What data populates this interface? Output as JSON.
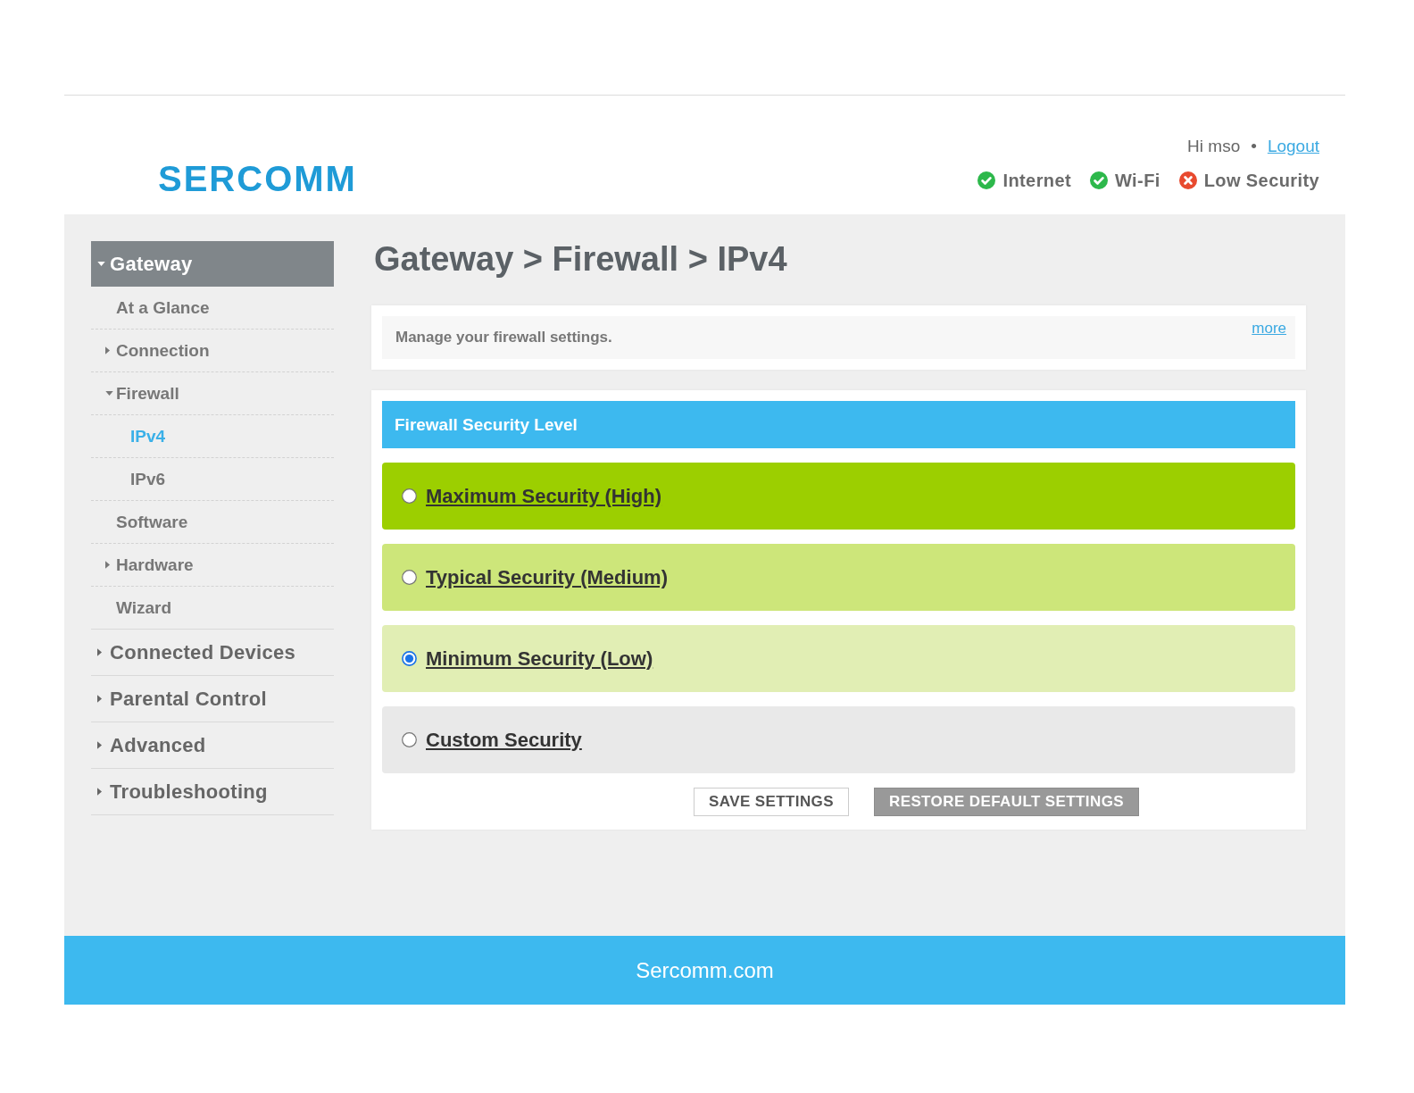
{
  "header": {
    "logo": "SERCOMM",
    "greeting": "Hi mso",
    "separator": "•",
    "logout": "Logout",
    "status": [
      {
        "label": "Internet",
        "ok": true
      },
      {
        "label": "Wi-Fi",
        "ok": true
      },
      {
        "label": "Low Security",
        "ok": false
      }
    ]
  },
  "sidebar": {
    "items": [
      {
        "label": "Gateway",
        "expanded": true,
        "selected": false,
        "children": [
          {
            "label": "At a Glance",
            "selected": false
          },
          {
            "label": "Connection",
            "expanded": false,
            "selected": false
          },
          {
            "label": "Firewall",
            "expanded": true,
            "selected": false,
            "children": [
              {
                "label": "IPv4",
                "selected": true
              },
              {
                "label": "IPv6",
                "selected": false
              }
            ]
          },
          {
            "label": "Software",
            "selected": false
          },
          {
            "label": "Hardware",
            "expanded": false,
            "selected": false
          },
          {
            "label": "Wizard",
            "selected": false
          }
        ]
      },
      {
        "label": "Connected Devices",
        "expanded": false,
        "selected": false
      },
      {
        "label": "Parental Control",
        "expanded": false,
        "selected": false
      },
      {
        "label": "Advanced",
        "expanded": false,
        "selected": false
      },
      {
        "label": "Troubleshooting",
        "expanded": false,
        "selected": false
      }
    ]
  },
  "page": {
    "title": "Gateway > Firewall > IPv4",
    "description": "Manage your firewall settings.",
    "more": "more"
  },
  "firewall": {
    "title": "Firewall Security Level",
    "options": [
      {
        "label": "Maximum Security (High)",
        "color": "#9ccf00",
        "selected": false
      },
      {
        "label": "Typical Security (Medium)",
        "color": "#cde67a",
        "selected": false
      },
      {
        "label": "Minimum Security (Low)",
        "color": "#e1eeb4",
        "selected": true
      },
      {
        "label": "Custom Security",
        "color": "#e9e9e9",
        "selected": false
      }
    ],
    "buttons": [
      {
        "label": "SAVE SETTINGS",
        "kind": "secondary"
      },
      {
        "label": "RESTORE DEFAULT SETTINGS",
        "kind": "primary"
      }
    ]
  },
  "footer": {
    "text": "Sercomm.com"
  }
}
